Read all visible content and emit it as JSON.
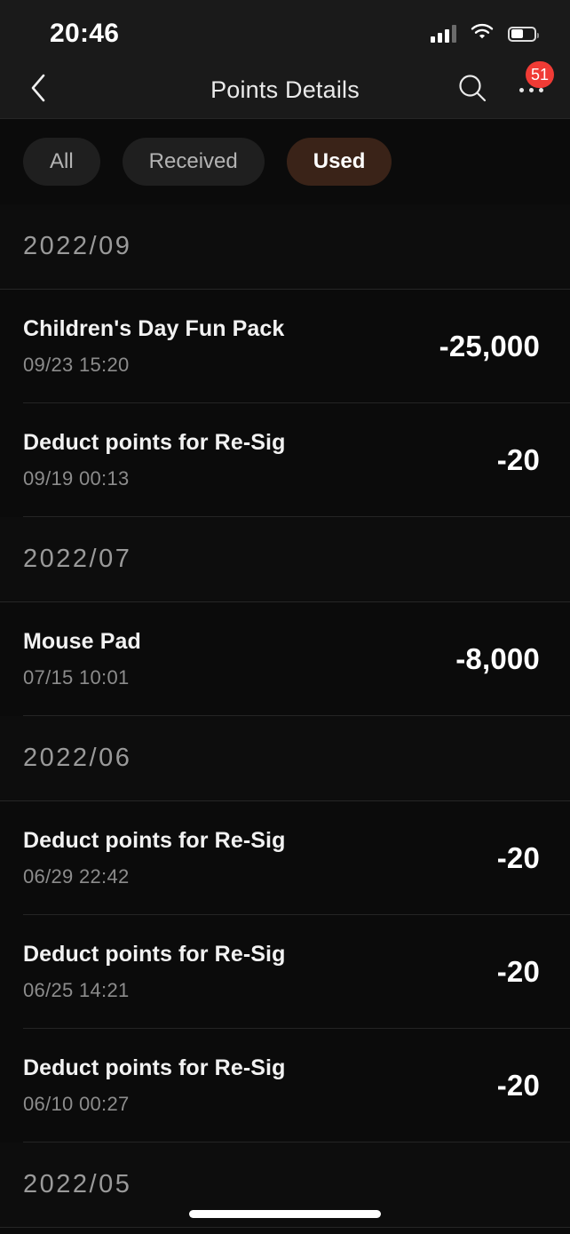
{
  "status_bar": {
    "time": "20:46",
    "signal_icon": "cellular-signal-icon",
    "wifi_icon": "wifi-icon",
    "battery_icon": "battery-icon",
    "battery_level_percent": 52
  },
  "nav_bar": {
    "back_icon": "chevron-left-icon",
    "title": "Points Details",
    "search_icon": "search-icon",
    "more_icon": "more-options-icon",
    "badge_count": "51",
    "badge_color": "#f03b35"
  },
  "filters": {
    "active_color": "#3a2318",
    "tabs": [
      {
        "label": "All",
        "active": false
      },
      {
        "label": "Received",
        "active": false
      },
      {
        "label": "Used",
        "active": true
      }
    ]
  },
  "sections": [
    {
      "month": "2022/09",
      "items": [
        {
          "title": "Children's Day Fun Pack",
          "date": "09/23 15:20",
          "amount": "-25,000"
        },
        {
          "title": "Deduct points for Re-Sig",
          "date": "09/19 00:13",
          "amount": "-20"
        }
      ]
    },
    {
      "month": "2022/07",
      "items": [
        {
          "title": "Mouse Pad",
          "date": "07/15 10:01",
          "amount": "-8,000"
        }
      ]
    },
    {
      "month": "2022/06",
      "items": [
        {
          "title": "Deduct points for Re-Sig",
          "date": "06/29 22:42",
          "amount": "-20"
        },
        {
          "title": "Deduct points for Re-Sig",
          "date": "06/25 14:21",
          "amount": "-20"
        },
        {
          "title": "Deduct points for Re-Sig",
          "date": "06/10 00:27",
          "amount": "-20"
        }
      ]
    },
    {
      "month": "2022/05",
      "items": []
    }
  ],
  "home_indicator": "home-indicator"
}
